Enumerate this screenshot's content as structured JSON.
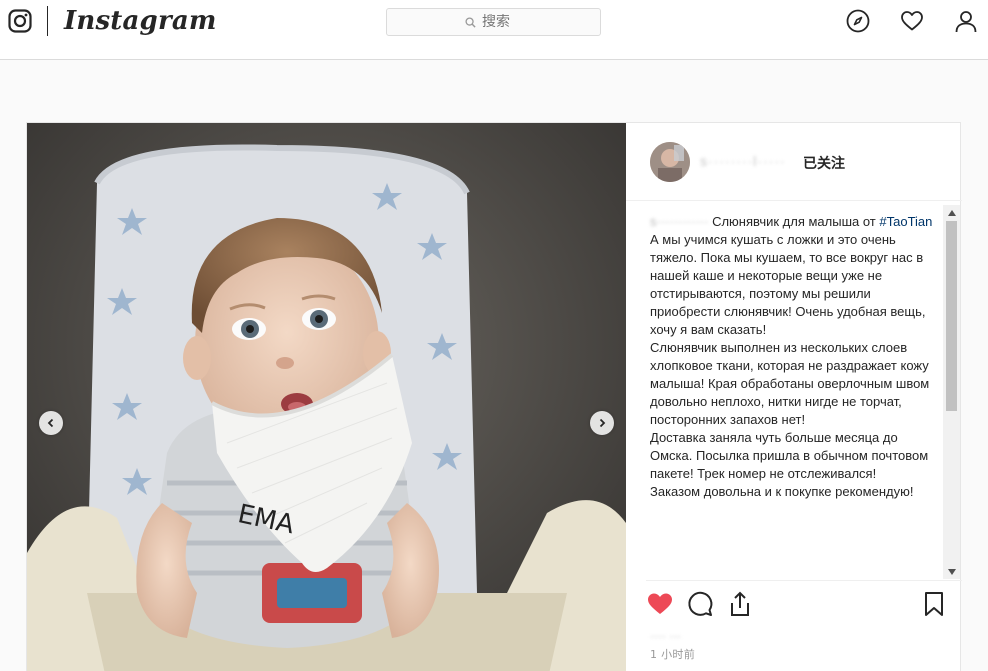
{
  "nav": {
    "wordmark": "Instagram",
    "search_placeholder": "搜索",
    "icons": [
      "instagram-logo-icon",
      "compass-icon",
      "heart-icon",
      "profile-icon"
    ]
  },
  "post": {
    "username": "s········l·····",
    "follow_status": "已关注",
    "caption_user": "s············",
    "caption_intro": "Слюнявчик для малыша от",
    "hashtag": "#TaoTian",
    "caption_lines": [
      "А мы учимся кушать с ложки и это очень тяжело. Пока мы кушаем, то все вокруг нас в нашей каше и некоторые вещи уже не отстирываются, поэтому мы решили приобрести слюнявчик! Очень удобная вещь, хочу я вам сказать!",
      "Слюнявчик выполнен из нескольких слоев хлопковое ткани, которая не раздражает кожу малыша! Края обработаны оверлочным швом довольно неплохо, нитки нигде не торчат, посторонних запахов нет!",
      "Доставка заняла чуть больше месяца до Омска. Посылка пришла в обычном почтовом пакете! Трек номер не отслеживался!",
      "Заказом довольна и к покупке рекомендую!"
    ],
    "likes": "···· ···",
    "timestamp": "1 小时前",
    "liked": true,
    "colors": {
      "like": "#ed4956",
      "hashtag": "#003569",
      "text": "#262626",
      "muted": "#999999"
    }
  },
  "photo_text": {
    "bib_letters": "ЕМА"
  }
}
